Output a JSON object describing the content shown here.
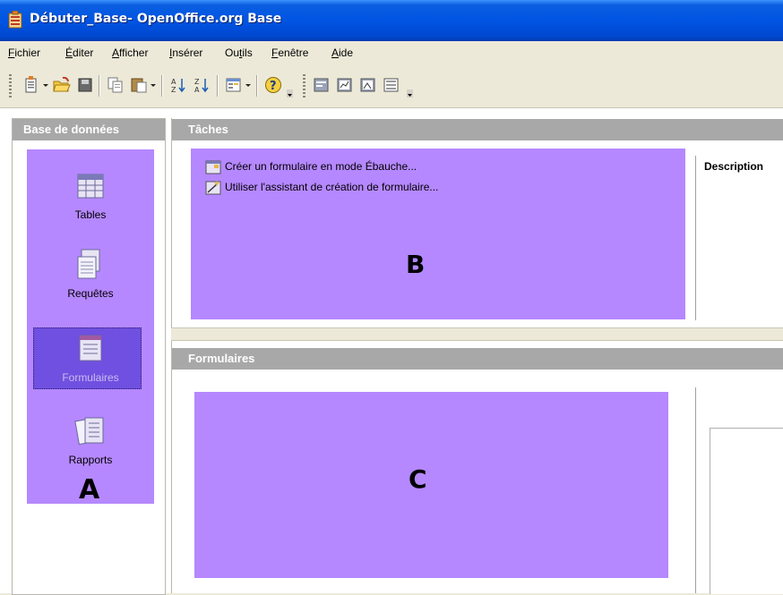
{
  "window": {
    "title": "Débuter_Base- OpenOffice.org Base",
    "icon": "openoffice-base-icon"
  },
  "menubar": {
    "items": [
      {
        "label": "Fichier",
        "access": "F"
      },
      {
        "label": "Éditer",
        "access": "É"
      },
      {
        "label": "Afficher",
        "access": "A"
      },
      {
        "label": "Insérer",
        "access": "I"
      },
      {
        "label": "Outils",
        "access": "t"
      },
      {
        "label": "Fenêtre",
        "access": "F"
      },
      {
        "label": "Aide",
        "access": "A"
      }
    ]
  },
  "toolbar": {
    "buttons": [
      "new-document-icon",
      "open-folder-icon",
      "save-icon",
      "copy-icon",
      "paste-icon",
      "sort-ascending-icon",
      "sort-descending-icon",
      "form-design-icon",
      "help-icon",
      "new-form-icon",
      "new-report-icon",
      "new-query-icon",
      "new-table-icon"
    ]
  },
  "database_pane": {
    "header": "Base de données",
    "items": [
      {
        "label": "Tables",
        "icon": "tables-icon",
        "selected": false
      },
      {
        "label": "Requêtes",
        "icon": "queries-icon",
        "selected": false
      },
      {
        "label": "Formulaires",
        "icon": "forms-icon",
        "selected": true
      },
      {
        "label": "Rapports",
        "icon": "reports-icon",
        "selected": false
      }
    ],
    "annotation": "A"
  },
  "tasks_pane": {
    "header": "Tâches",
    "tasks": [
      "Créer un formulaire en mode Ébauche...",
      "Utiliser l'assistant de création de formulaire..."
    ],
    "description_label": "Description",
    "annotation": "B"
  },
  "forms_pane": {
    "header": "Formulaires",
    "annotation": "C"
  },
  "colors": {
    "overlay": "#b588ff",
    "selection": "#7050e0",
    "header_bg": "#a8a8a8",
    "titlebar": "#0054e3"
  }
}
